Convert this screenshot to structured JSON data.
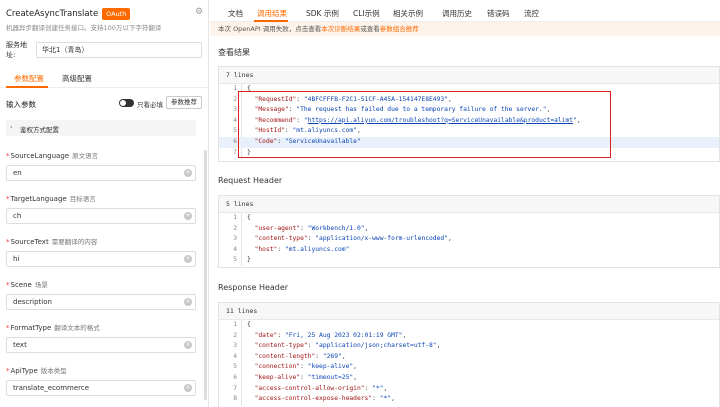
{
  "left": {
    "api_name": "CreateAsyncTranslate",
    "oauth_badge": "OAuth",
    "description": "机器异步翻译创建任务接口。支持100万以下字符翻译",
    "region_label": "服务地址:",
    "region_value": "华北1（青岛）",
    "tabs": [
      "参数配置",
      "高级配置"
    ],
    "input_params_title": "输入参数",
    "required_only_label": "只看必填",
    "param_recommend_button": "参数推荐",
    "auth_section_label": "鉴权方式配置",
    "fields": [
      {
        "name": "SourceLanguage",
        "desc": "原文语言",
        "value": "en",
        "required": true
      },
      {
        "name": "TargetLanguage",
        "desc": "目标语言",
        "value": "ch",
        "required": true
      },
      {
        "name": "SourceText",
        "desc": "需要翻译的内容",
        "value": "hi",
        "required": true
      },
      {
        "name": "Scene",
        "desc": "场景",
        "value": "description",
        "required": true
      },
      {
        "name": "FormatType",
        "desc": "翻译文本的格式",
        "value": "text",
        "required": true
      },
      {
        "name": "ApiType",
        "desc": "版本类型",
        "value": "translate_ecommerce",
        "required": true
      }
    ]
  },
  "right": {
    "tabs": [
      "文档",
      "调用结果",
      "SDK 示例",
      "CLI示例",
      "相关示例",
      "调用历史",
      "错误码",
      "流控"
    ],
    "notice_text": "本次 OpenAPI 调用失败，点击查看",
    "notice_link": "本次诊断结果",
    "notice_mid": "或查看",
    "notice_link2": "参数组合推荐",
    "view_result_title": "查看结果",
    "result_lines_count": "7 lines",
    "result_lines": [
      {
        "n": "1",
        "parts": [
          {
            "t": "{",
            "c": ""
          }
        ]
      },
      {
        "n": "2",
        "parts": [
          {
            "t": "  \"RequestId\"",
            "c": "k"
          },
          {
            "t": ": ",
            "c": ""
          },
          {
            "t": "\"4BFCFFFB-F2C1-51CF-A45A-154147E8E493\"",
            "c": "v"
          },
          {
            "t": ",",
            "c": ""
          }
        ]
      },
      {
        "n": "3",
        "parts": [
          {
            "t": "  \"Message\"",
            "c": "k"
          },
          {
            "t": ": ",
            "c": ""
          },
          {
            "t": "\"The request has failed due to a temporary failure of the server.\"",
            "c": "v"
          },
          {
            "t": ",",
            "c": ""
          }
        ]
      },
      {
        "n": "4",
        "parts": [
          {
            "t": "  \"Recommend\"",
            "c": "k"
          },
          {
            "t": ": ",
            "c": ""
          },
          {
            "t": "\"",
            "c": "v"
          },
          {
            "t": "https://api.aliyun.com/troubleshoot?q=ServiceUnavailable&product=alimt",
            "c": "u"
          },
          {
            "t": "\"",
            "c": "v"
          },
          {
            "t": ",",
            "c": ""
          }
        ]
      },
      {
        "n": "5",
        "parts": [
          {
            "t": "  \"HostId\"",
            "c": "k"
          },
          {
            "t": ": ",
            "c": ""
          },
          {
            "t": "\"mt.aliyuncs.com\"",
            "c": "v"
          },
          {
            "t": ",",
            "c": ""
          }
        ]
      },
      {
        "n": "6",
        "parts": [
          {
            "t": "  \"Code\"",
            "c": "k"
          },
          {
            "t": ": ",
            "c": ""
          },
          {
            "t": "\"ServiceUnavailable\"",
            "c": "v"
          }
        ],
        "hl": true
      },
      {
        "n": "7",
        "parts": [
          {
            "t": "}",
            "c": ""
          }
        ]
      }
    ],
    "request_header_title": "Request Header",
    "request_lines_count": "5 lines",
    "request_lines": [
      {
        "n": "1",
        "parts": [
          {
            "t": "{",
            "c": ""
          }
        ]
      },
      {
        "n": "2",
        "parts": [
          {
            "t": "  \"user-agent\"",
            "c": "k"
          },
          {
            "t": ": ",
            "c": ""
          },
          {
            "t": "\"Workbench/1.0\"",
            "c": "v"
          },
          {
            "t": ",",
            "c": ""
          }
        ]
      },
      {
        "n": "3",
        "parts": [
          {
            "t": "  \"content-type\"",
            "c": "k"
          },
          {
            "t": ": ",
            "c": ""
          },
          {
            "t": "\"application/x-www-form-urlencoded\"",
            "c": "v"
          },
          {
            "t": ",",
            "c": ""
          }
        ]
      },
      {
        "n": "4",
        "parts": [
          {
            "t": "  \"host\"",
            "c": "k"
          },
          {
            "t": ": ",
            "c": ""
          },
          {
            "t": "\"mt.aliyuncs.com\"",
            "c": "v"
          }
        ]
      },
      {
        "n": "5",
        "parts": [
          {
            "t": "}",
            "c": ""
          }
        ]
      }
    ],
    "response_header_title": "Response Header",
    "response_lines_count": "11 lines",
    "response_lines": [
      {
        "n": "1",
        "parts": [
          {
            "t": "{",
            "c": ""
          }
        ]
      },
      {
        "n": "2",
        "parts": [
          {
            "t": "  \"date\"",
            "c": "k"
          },
          {
            "t": ": ",
            "c": ""
          },
          {
            "t": "\"Fri, 25 Aug 2023 02:01:19 GMT\"",
            "c": "v"
          },
          {
            "t": ",",
            "c": ""
          }
        ]
      },
      {
        "n": "3",
        "parts": [
          {
            "t": "  \"content-type\"",
            "c": "k"
          },
          {
            "t": ": ",
            "c": ""
          },
          {
            "t": "\"application/json;charset=utf-8\"",
            "c": "v"
          },
          {
            "t": ",",
            "c": ""
          }
        ]
      },
      {
        "n": "4",
        "parts": [
          {
            "t": "  \"content-length\"",
            "c": "k"
          },
          {
            "t": ": ",
            "c": ""
          },
          {
            "t": "\"269\"",
            "c": "v"
          },
          {
            "t": ",",
            "c": ""
          }
        ]
      },
      {
        "n": "5",
        "parts": [
          {
            "t": "  \"connection\"",
            "c": "k"
          },
          {
            "t": ": ",
            "c": ""
          },
          {
            "t": "\"keep-alive\"",
            "c": "v"
          },
          {
            "t": ",",
            "c": ""
          }
        ]
      },
      {
        "n": "6",
        "parts": [
          {
            "t": "  \"keep-alive\"",
            "c": "k"
          },
          {
            "t": ": ",
            "c": ""
          },
          {
            "t": "\"timeout=25\"",
            "c": "v"
          },
          {
            "t": ",",
            "c": ""
          }
        ]
      },
      {
        "n": "7",
        "parts": [
          {
            "t": "  \"access-control-allow-origin\"",
            "c": "k"
          },
          {
            "t": ": ",
            "c": ""
          },
          {
            "t": "\"*\"",
            "c": "v"
          },
          {
            "t": ",",
            "c": ""
          }
        ]
      },
      {
        "n": "8",
        "parts": [
          {
            "t": "  \"access-control-expose-headers\"",
            "c": "k"
          },
          {
            "t": ": ",
            "c": ""
          },
          {
            "t": "\"*\"",
            "c": "v"
          },
          {
            "t": ",",
            "c": ""
          }
        ]
      }
    ],
    "accent_color": "#ff6a00"
  }
}
